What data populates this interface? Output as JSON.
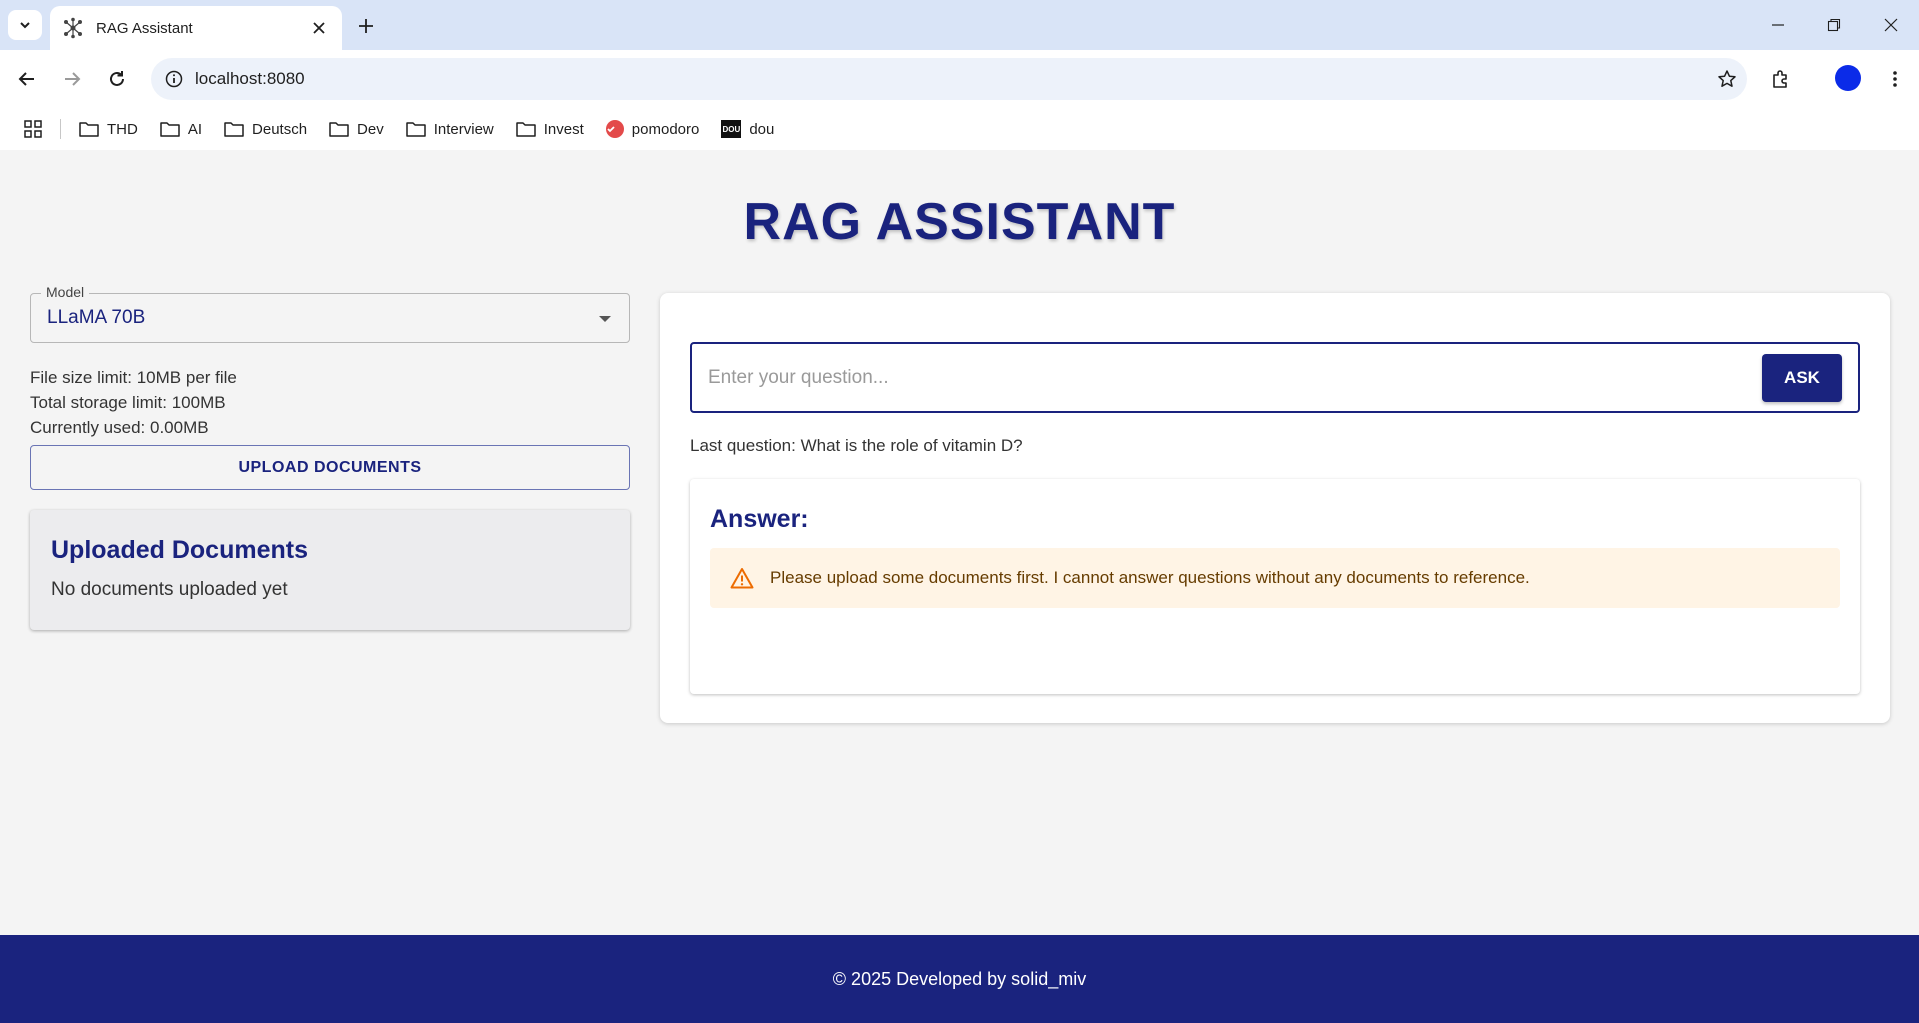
{
  "browser": {
    "tab_title": "RAG Assistant",
    "url": "localhost:8080",
    "bookmarks": [
      {
        "label": "THD",
        "icon": "folder-icon"
      },
      {
        "label": "AI",
        "icon": "folder-icon"
      },
      {
        "label": "Deutsch",
        "icon": "folder-icon"
      },
      {
        "label": "Dev",
        "icon": "folder-icon"
      },
      {
        "label": "Interview",
        "icon": "folder-icon"
      },
      {
        "label": "Invest",
        "icon": "folder-icon"
      },
      {
        "label": "pomodoro",
        "icon": "pomodoro-icon"
      },
      {
        "label": "dou",
        "icon": "dou-icon"
      }
    ],
    "dou_logo_text": "DOU"
  },
  "app": {
    "title": "RAG ASSISTANT",
    "model": {
      "label": "Model",
      "value": "LLaMA 70B"
    },
    "limits": {
      "file_size": "File size limit: 10MB per file",
      "total_storage": "Total storage limit: 100MB",
      "used": "Currently used: 0.00MB"
    },
    "upload_button": "UPLOAD DOCUMENTS",
    "documents": {
      "title": "Uploaded Documents",
      "empty_text": "No documents uploaded yet"
    },
    "question": {
      "placeholder": "Enter your question...",
      "value": "",
      "ask_button": "ASK",
      "last_question": "Last question: What is the role of vitamin D?"
    },
    "answer": {
      "title": "Answer:",
      "alert": "Please upload some documents first. I cannot answer questions without any documents to reference."
    },
    "footer": "© 2025 Developed by solid_miv"
  },
  "colors": {
    "primary": "#1a237e",
    "warning_bg": "#fff4e5",
    "warning_icon": "#ed6c02",
    "warning_text": "#663c00",
    "tabstrip": "#d9e4f7",
    "profile": "#0b2be8"
  }
}
